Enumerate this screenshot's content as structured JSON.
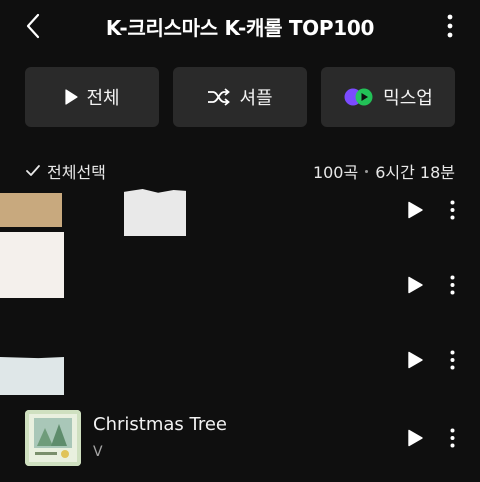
{
  "header": {
    "title": "K-크리스마스 K-캐롤 TOP100"
  },
  "actions": {
    "play_all": "전체",
    "shuffle": "셔플",
    "mixup": "믹스업"
  },
  "selection": {
    "select_all": "전체선택",
    "count": "100곡",
    "duration": "6시간 18분"
  },
  "tracks": [
    {
      "title": "",
      "artist": ""
    },
    {
      "title": "",
      "artist": ""
    },
    {
      "title": "",
      "artist": ""
    },
    {
      "title": "Christmas Tree",
      "artist": "V"
    }
  ],
  "colors": {
    "background": "#0f0f0f",
    "button_bg": "#2a2a2a",
    "mix_purple": "#7b4bff",
    "mix_green": "#22c95a"
  },
  "icons": [
    "back-icon",
    "more-vertical-icon",
    "play-icon",
    "shuffle-icon",
    "mixup-icon",
    "check-icon",
    "kebab-icon"
  ]
}
